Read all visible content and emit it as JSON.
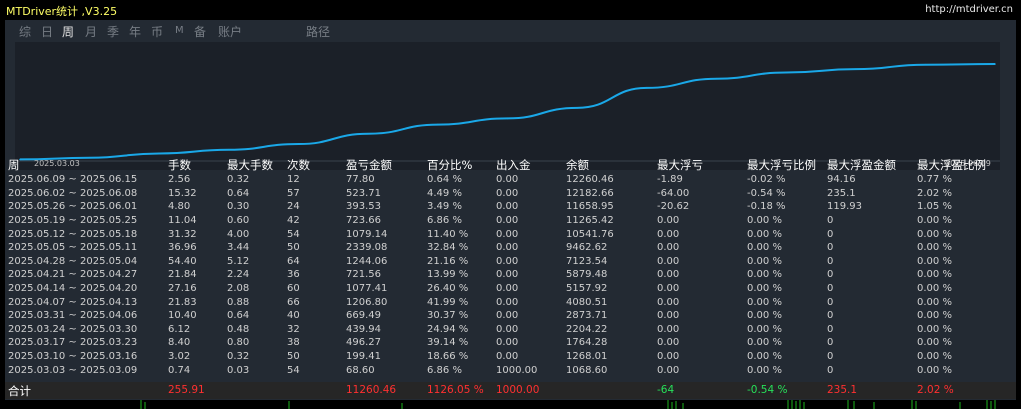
{
  "window": {
    "title": "MTDriver统计 ,V3.25",
    "url": "http://mtdriver.cn"
  },
  "tabs": [
    {
      "label": "综",
      "active": false
    },
    {
      "label": "日",
      "active": false
    },
    {
      "label": "周",
      "active": true
    },
    {
      "label": "月",
      "active": false
    },
    {
      "label": "季",
      "active": false
    },
    {
      "label": "年",
      "active": false
    },
    {
      "label": "币",
      "active": false
    },
    {
      "label": "M",
      "active": false
    },
    {
      "label": "备",
      "active": false
    },
    {
      "label": "账户",
      "active": false
    },
    {
      "label": "路径",
      "active": false
    }
  ],
  "colors": {
    "line": "#1aa8e8",
    "loss": "#ff3030",
    "gain": "#27e05a",
    "panel": "#232a33"
  },
  "chart_data": {
    "type": "line",
    "x": [
      "2025.03.09",
      "2025.03.16",
      "2025.03.23",
      "2025.03.30",
      "2025.04.06",
      "2025.04.13",
      "2025.04.20",
      "2025.04.27",
      "2025.05.04",
      "2025.05.11",
      "2025.05.18",
      "2025.05.25",
      "2025.06.01",
      "2025.06.08",
      "2025.06.15"
    ],
    "series": [
      {
        "values": [
          1068.6,
          1268.01,
          1764.28,
          2204.22,
          2873.71,
          4080.51,
          5157.92,
          5879.48,
          7123.54,
          9462.62,
          10541.76,
          11265.42,
          11658.95,
          12182.66,
          12260.46
        ]
      }
    ],
    "ylim": [
      1000,
      12500
    ],
    "tick_labels": [
      "2025.03.03",
      "2025.06.09"
    ],
    "grid": false
  },
  "table": {
    "headers": [
      "周",
      "手数",
      "最大手数",
      "次数",
      "盈亏金额",
      "百分比%",
      "出入金",
      "余额",
      "最大浮亏",
      "最大浮亏比例",
      "最大浮盈金额",
      "最大浮盈比例"
    ],
    "rows": [
      [
        "2025.06.09 ~ 2025.06.15",
        "2.56",
        "0.32",
        "12",
        "77.80",
        "0.64 %",
        "0.00",
        "12260.46",
        "-1.89",
        "-0.02 %",
        "94.16",
        "0.77 %"
      ],
      [
        "2025.06.02 ~ 2025.06.08",
        "15.32",
        "0.64",
        "57",
        "523.71",
        "4.49 %",
        "0.00",
        "12182.66",
        "-64.00",
        "-0.54 %",
        "235.1",
        "2.02 %"
      ],
      [
        "2025.05.26 ~ 2025.06.01",
        "4.80",
        "0.30",
        "24",
        "393.53",
        "3.49 %",
        "0.00",
        "11658.95",
        "-20.62",
        "-0.18 %",
        "119.93",
        "1.05 %"
      ],
      [
        "2025.05.19 ~ 2025.05.25",
        "11.04",
        "0.60",
        "42",
        "723.66",
        "6.86 %",
        "0.00",
        "11265.42",
        "0.00",
        "0.00 %",
        "0",
        "0.00 %"
      ],
      [
        "2025.05.12 ~ 2025.05.18",
        "31.32",
        "4.00",
        "54",
        "1079.14",
        "11.40 %",
        "0.00",
        "10541.76",
        "0.00",
        "0.00 %",
        "0",
        "0.00 %"
      ],
      [
        "2025.05.05 ~ 2025.05.11",
        "36.96",
        "3.44",
        "50",
        "2339.08",
        "32.84 %",
        "0.00",
        "9462.62",
        "0.00",
        "0.00 %",
        "0",
        "0.00 %"
      ],
      [
        "2025.04.28 ~ 2025.05.04",
        "54.40",
        "5.12",
        "64",
        "1244.06",
        "21.16 %",
        "0.00",
        "7123.54",
        "0.00",
        "0.00 %",
        "0",
        "0.00 %"
      ],
      [
        "2025.04.21 ~ 2025.04.27",
        "21.84",
        "2.24",
        "36",
        "721.56",
        "13.99 %",
        "0.00",
        "5879.48",
        "0.00",
        "0.00 %",
        "0",
        "0.00 %"
      ],
      [
        "2025.04.14 ~ 2025.04.20",
        "27.16",
        "2.08",
        "60",
        "1077.41",
        "26.40 %",
        "0.00",
        "5157.92",
        "0.00",
        "0.00 %",
        "0",
        "0.00 %"
      ],
      [
        "2025.04.07 ~ 2025.04.13",
        "21.83",
        "0.88",
        "66",
        "1206.80",
        "41.99 %",
        "0.00",
        "4080.51",
        "0.00",
        "0.00 %",
        "0",
        "0.00 %"
      ],
      [
        "2025.03.31 ~ 2025.04.06",
        "10.40",
        "0.64",
        "40",
        "669.49",
        "30.37 %",
        "0.00",
        "2873.71",
        "0.00",
        "0.00 %",
        "0",
        "0.00 %"
      ],
      [
        "2025.03.24 ~ 2025.03.30",
        "6.12",
        "0.48",
        "32",
        "439.94",
        "24.94 %",
        "0.00",
        "2204.22",
        "0.00",
        "0.00 %",
        "0",
        "0.00 %"
      ],
      [
        "2025.03.17 ~ 2025.03.23",
        "8.40",
        "0.80",
        "38",
        "496.27",
        "39.14 %",
        "0.00",
        "1764.28",
        "0.00",
        "0.00 %",
        "0",
        "0.00 %"
      ],
      [
        "2025.03.10 ~ 2025.03.16",
        "3.02",
        "0.32",
        "50",
        "199.41",
        "18.66 %",
        "0.00",
        "1268.01",
        "0.00",
        "0.00 %",
        "0",
        "0.00 %"
      ],
      [
        "2025.03.03 ~ 2025.03.09",
        "0.74",
        "0.03",
        "54",
        "68.60",
        "6.86 %",
        "1000.00",
        "1068.60",
        "0.00",
        "0.00 %",
        "0",
        "0.00 %"
      ]
    ],
    "total": {
      "label": "合计",
      "lots": "255.91",
      "profit": "11260.46",
      "percent": "1126.05 %",
      "deposit": "1000.00",
      "max_float_loss": "-64",
      "max_float_loss_pct": "-0.54 %",
      "max_float_profit": "235.1",
      "max_float_profit_pct": "2.02 %"
    }
  }
}
